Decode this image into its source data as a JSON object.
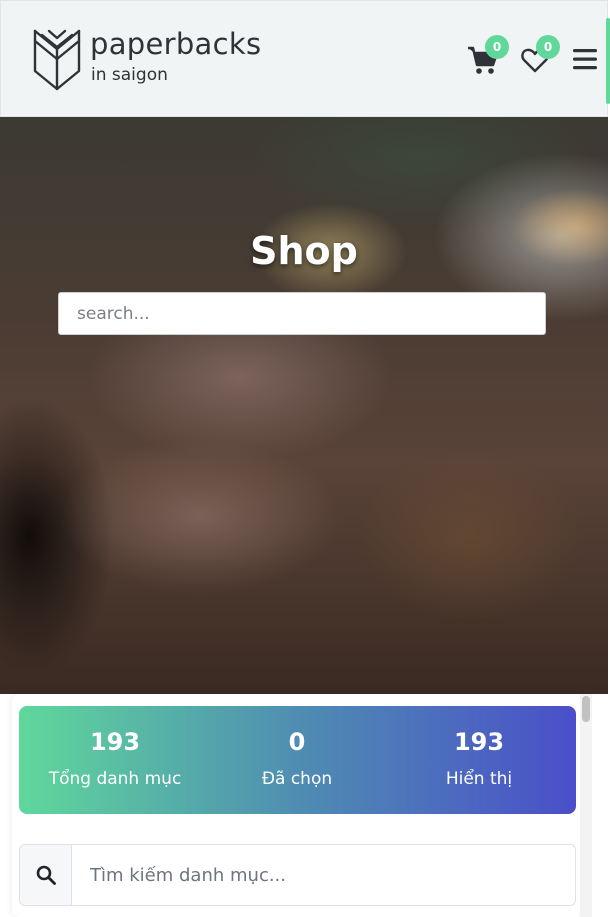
{
  "header": {
    "logo_title": "paperbacks",
    "logo_subtitle": "in saigon",
    "cart_count": "0",
    "wishlist_count": "0",
    "icons": [
      "book-logo-icon",
      "cart-icon",
      "heart-icon",
      "menu-icon"
    ],
    "accent_color": "#5fd89a"
  },
  "hero": {
    "title": "Shop",
    "search_placeholder": "search..."
  },
  "stats": [
    {
      "value": "193",
      "label": "Tổng danh mục"
    },
    {
      "value": "0",
      "label": "Đã chọn"
    },
    {
      "value": "193",
      "label": "Hiển thị"
    }
  ],
  "category_search": {
    "placeholder": "Tìm kiếm danh mục...",
    "icon": "search-icon"
  },
  "colors": {
    "gradient_start": "#5fd89b",
    "gradient_end": "#4a4fc9",
    "header_bg": "#f0f4f5"
  }
}
